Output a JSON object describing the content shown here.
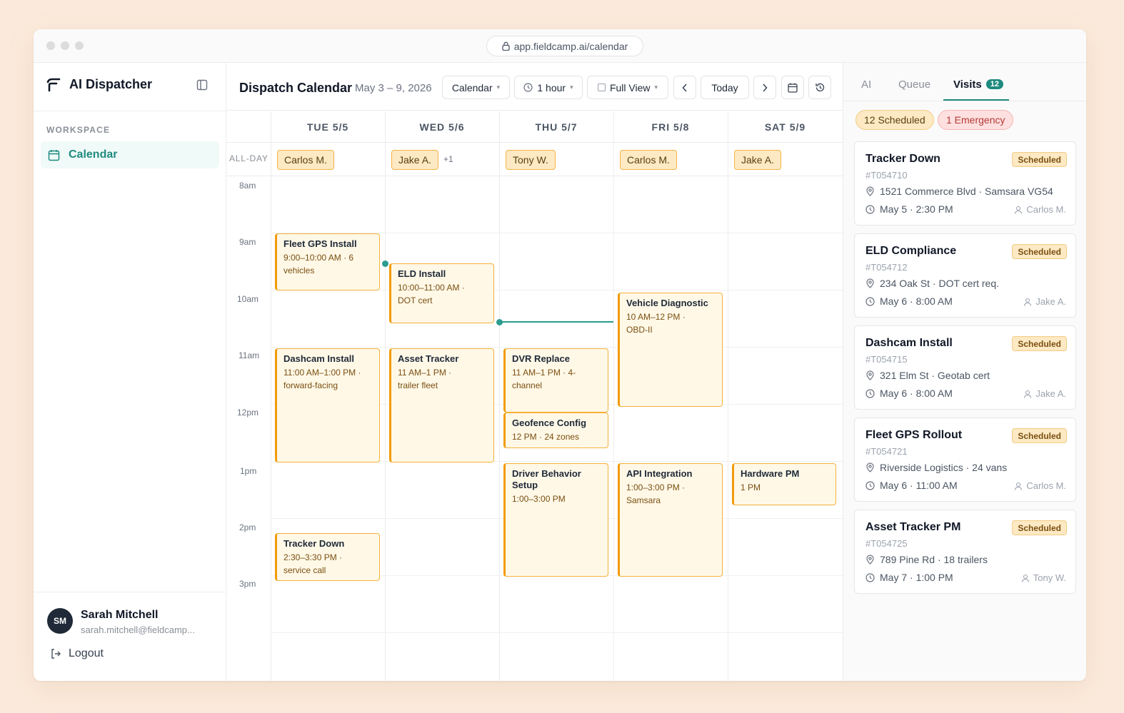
{
  "browser": {
    "url": "app.fieldcamp.ai/calendar"
  },
  "sidebar": {
    "brand": "AI Dispatcher",
    "section_label": "WORKSPACE",
    "nav_calendar": "Calendar",
    "user_initials": "SM",
    "user_name": "Sarah Mitchell",
    "user_email": "sarah.mitchell@fieldcamp...",
    "logout": "Logout"
  },
  "toolbar": {
    "title": "Dispatch Calendar",
    "date_range": "May 3 – 9, 2026",
    "view_select": "Calendar",
    "interval_select": "1 hour",
    "full_view": "Full View",
    "today": "Today"
  },
  "calendar": {
    "days": [
      "TUE 5/5",
      "WED 5/6",
      "THU 5/7",
      "FRI 5/8",
      "SAT 5/9"
    ],
    "allday_label": "ALL-DAY",
    "allday": [
      "Carlos M.",
      "Jake A.",
      "Tony W.",
      "Carlos M.",
      "Jake A."
    ],
    "allday_more": "+1",
    "hours": [
      "8am",
      "9am",
      "10am",
      "11am",
      "12pm",
      "1pm",
      "2pm",
      "3pm"
    ],
    "events": [
      {
        "title": "Fleet GPS Install",
        "sub": "9:00–10:00 AM · 6 vehicles"
      },
      {
        "title": "ELD Install",
        "sub": "10:00–11:00 AM · DOT cert"
      },
      {
        "title": "Vehicle Diagnostic",
        "sub": "10 AM–12 PM · OBD-II"
      },
      {
        "title": "Dashcam Install",
        "sub": "11:00 AM–1:00 PM · forward-facing"
      },
      {
        "title": "Asset Tracker",
        "sub": "11 AM–1 PM · trailer fleet"
      },
      {
        "title": "DVR Replace",
        "sub": "11 AM–1 PM · 4-channel"
      },
      {
        "title": "Geofence Config",
        "sub": "12 PM · 24 zones"
      },
      {
        "title": "Driver Behavior Setup",
        "sub": "1:00–3:00 PM"
      },
      {
        "title": "API Integration",
        "sub": "1:00–3:00 PM · Samsara"
      },
      {
        "title": "Hardware PM",
        "sub": "1 PM"
      },
      {
        "title": "Tracker Down",
        "sub": "2:30–3:30 PM · service call"
      }
    ]
  },
  "panel": {
    "tabs": {
      "ai": "AI",
      "queue": "Queue",
      "visits": "Visits",
      "visits_count": "12"
    },
    "pill_scheduled": "12 Scheduled",
    "pill_emergency": "1 Emergency",
    "cards": [
      {
        "title": "Tracker Down",
        "id": "#T054710",
        "badge": "Scheduled",
        "location": "1521 Commerce Blvd · Samsara VG54",
        "time": "May 5 · 2:30 PM",
        "tech": "Carlos M."
      },
      {
        "title": "ELD Compliance",
        "id": "#T054712",
        "badge": "Scheduled",
        "location": "234 Oak St · DOT cert req.",
        "time": "May 6 · 8:00 AM",
        "tech": "Jake A."
      },
      {
        "title": "Dashcam Install",
        "id": "#T054715",
        "badge": "Scheduled",
        "location": "321 Elm St · Geotab cert",
        "time": "May 6 · 8:00 AM",
        "tech": "Jake A."
      },
      {
        "title": "Fleet GPS Rollout",
        "id": "#T054721",
        "badge": "Scheduled",
        "location": "Riverside Logistics · 24 vans",
        "time": "May 6 · 11:00 AM",
        "tech": "Carlos M."
      },
      {
        "title": "Asset Tracker PM",
        "id": "#T054725",
        "badge": "Scheduled",
        "location": "789 Pine Rd · 18 trailers",
        "time": "May 7 · 1:00 PM",
        "tech": "Tony W."
      }
    ]
  },
  "colors": {
    "accent": "#1f8a7e",
    "event_border": "#f5b13b",
    "event_fill": "#fff8e7",
    "emergency": "#b53a35"
  }
}
